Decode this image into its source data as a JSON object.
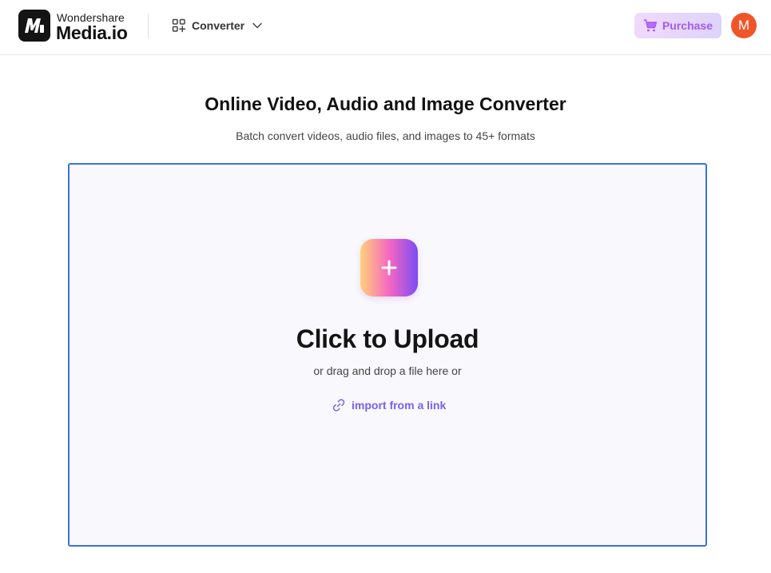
{
  "header": {
    "brand_top": "Wondershare",
    "brand_main": "Media.io",
    "nav_menu_label": "Converter",
    "purchase_label": "Purchase",
    "avatar_initial": "M"
  },
  "main": {
    "title": "Online Video, Audio and Image Converter",
    "subtitle": "Batch convert videos, audio files, and images to 45+ formats",
    "upload": {
      "title": "Click to Upload",
      "subtitle": "or drag and drop a file here or",
      "import_link_label": "import from a link"
    }
  },
  "icons": {
    "logo": "mediaio-logo-icon",
    "nav_menu": "grid-apps-icon",
    "dropdown": "chevron-down-icon",
    "purchase": "cart-icon",
    "upload": "plus-icon",
    "import_link": "link-icon"
  },
  "colors": {
    "accent_border": "#3a73d8",
    "purchase_text": "#a35bf0",
    "link_text": "#7761ee",
    "avatar_bg": "#f0552a",
    "dropzone_bg": "#f8f8fd"
  }
}
